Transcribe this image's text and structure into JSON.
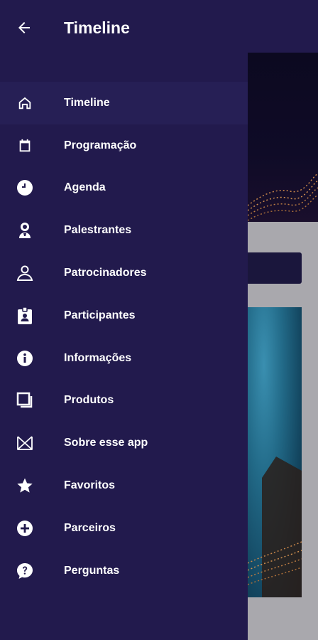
{
  "header": {
    "title": "Timeline",
    "back_icon": "arrow-left-icon"
  },
  "menu": {
    "items": [
      {
        "label": "Timeline",
        "icon": "home-icon",
        "active": true
      },
      {
        "label": "Programação",
        "icon": "calendar-icon"
      },
      {
        "label": "Agenda",
        "icon": "clock-icon"
      },
      {
        "label": "Palestrantes",
        "icon": "speaker-icon"
      },
      {
        "label": "Patrocinadores",
        "icon": "sponsor-icon"
      },
      {
        "label": "Participantes",
        "icon": "badge-icon"
      },
      {
        "label": "Informações",
        "icon": "info-icon"
      },
      {
        "label": "Produtos",
        "icon": "products-icon"
      },
      {
        "label": "Sobre esse app",
        "icon": "about-icon"
      },
      {
        "label": "Favoritos",
        "icon": "star-icon"
      },
      {
        "label": "Parceiros",
        "icon": "add-circle-icon"
      },
      {
        "label": "Perguntas",
        "icon": "question-icon"
      }
    ]
  },
  "colors": {
    "drawer_bg": "#221a4d",
    "active_bg": "#261f55",
    "text": "#ffffff"
  }
}
